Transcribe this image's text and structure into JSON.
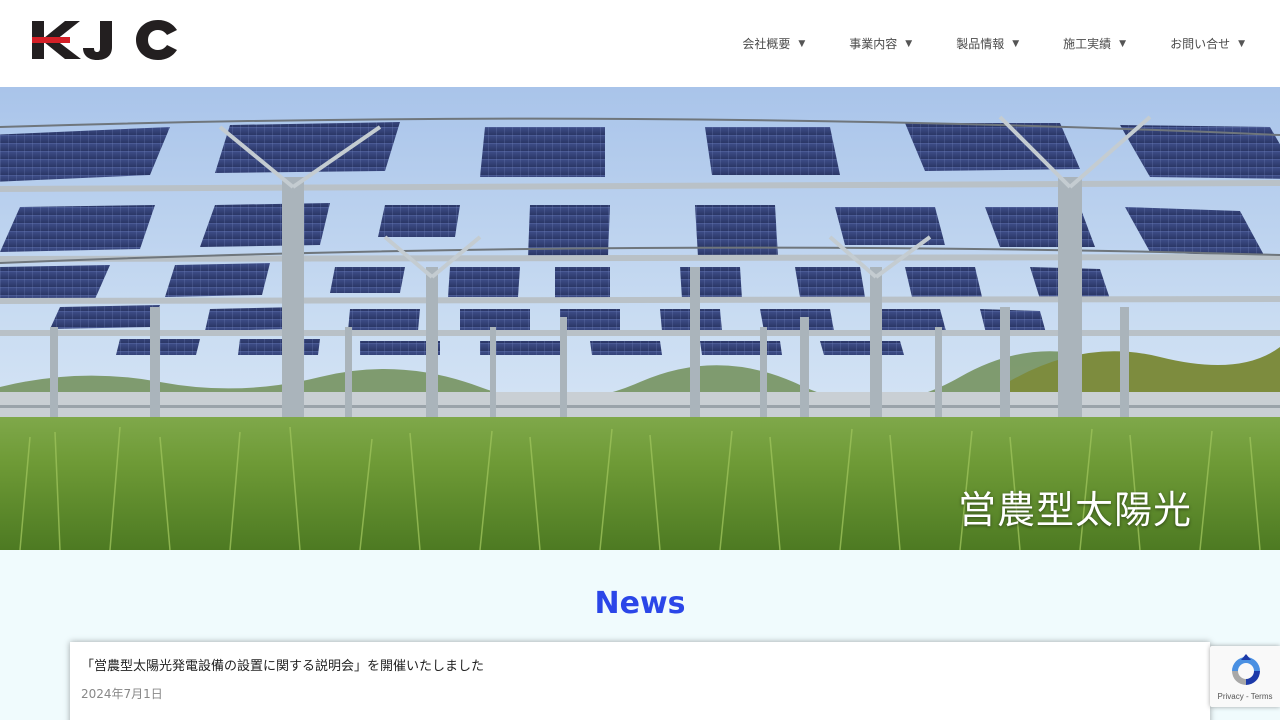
{
  "header": {
    "logo_text": "KJC",
    "nav": [
      {
        "label": "会社概要",
        "caret": "▼"
      },
      {
        "label": "事業内容",
        "caret": "▼"
      },
      {
        "label": "製品情報",
        "caret": "▼"
      },
      {
        "label": "施工実績",
        "caret": "▼"
      },
      {
        "label": "お問い合せ",
        "caret": "▼"
      }
    ]
  },
  "hero": {
    "caption": "営農型太陽光"
  },
  "news": {
    "title": "News",
    "items": [
      {
        "title": "「営農型太陽光発電設備の設置に関する説明会」を開催いたしました",
        "date": "2024年7月1日"
      }
    ]
  },
  "recaptcha": {
    "links": "Privacy - Terms"
  },
  "colors": {
    "accent": "#2b46e8",
    "logo_red": "#d42027",
    "logo_dark": "#231f20"
  }
}
